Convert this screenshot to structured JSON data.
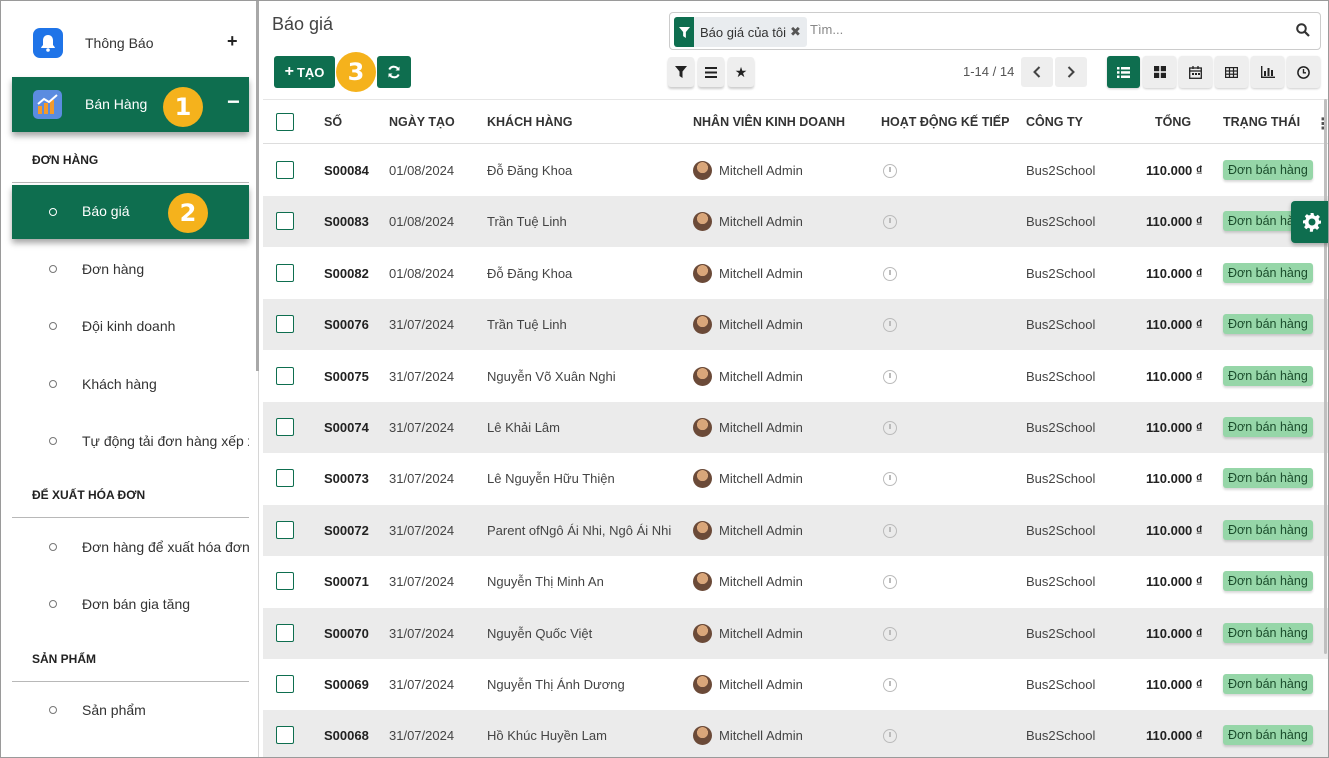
{
  "sidebar": {
    "notifications_label": "Thông Báo",
    "sales_label": "Bán Hàng",
    "sections": {
      "orders": "ĐƠN HÀNG",
      "invoice": "ĐỂ XUẤT HÓA ĐƠN",
      "products": "SẢN PHẨM"
    },
    "items": [
      {
        "label": "Báo giá"
      },
      {
        "label": "Đơn hàng"
      },
      {
        "label": "Đội kinh doanh"
      },
      {
        "label": "Khách hàng"
      },
      {
        "label": "Tự động tải đơn hàng xếp xe"
      },
      {
        "label": "Đơn hàng để xuất hóa đơn"
      },
      {
        "label": "Đơn bán gia tăng"
      },
      {
        "label": "Sản phẩm"
      }
    ]
  },
  "badges": [
    "1",
    "2",
    "3"
  ],
  "header": {
    "title": "Báo giá",
    "facet_label": "Báo giá của tôi",
    "search_placeholder": "Tìm...",
    "create_label": "TẠO",
    "pager": "1-14 / 14"
  },
  "table": {
    "columns": [
      "SỐ",
      "NGÀY TẠO",
      "KHÁCH HÀNG",
      "NHÂN VIÊN KINH DOANH",
      "HOẠT ĐỘNG KẾ TIẾP",
      "CÔNG TY",
      "TỔNG",
      "TRẠNG THÁI"
    ],
    "rows": [
      {
        "number": "S00084",
        "date": "01/08/2024",
        "customer": "Đỗ Đăng Khoa",
        "salesperson": "Mitchell Admin",
        "company": "Bus2School",
        "total": "110.000 ₫",
        "status": "Đơn bán hàng"
      },
      {
        "number": "S00083",
        "date": "01/08/2024",
        "customer": "Trần Tuệ Linh",
        "salesperson": "Mitchell Admin",
        "company": "Bus2School",
        "total": "110.000 ₫",
        "status": "Đơn bán hàng"
      },
      {
        "number": "S00082",
        "date": "01/08/2024",
        "customer": "Đỗ Đăng Khoa",
        "salesperson": "Mitchell Admin",
        "company": "Bus2School",
        "total": "110.000 ₫",
        "status": "Đơn bán hàng"
      },
      {
        "number": "S00076",
        "date": "31/07/2024",
        "customer": "Trần Tuệ Linh",
        "salesperson": "Mitchell Admin",
        "company": "Bus2School",
        "total": "110.000 ₫",
        "status": "Đơn bán hàng"
      },
      {
        "number": "S00075",
        "date": "31/07/2024",
        "customer": "Nguyễn Võ Xuân Nghi",
        "salesperson": "Mitchell Admin",
        "company": "Bus2School",
        "total": "110.000 ₫",
        "status": "Đơn bán hàng"
      },
      {
        "number": "S00074",
        "date": "31/07/2024",
        "customer": "Lê Khải Lâm",
        "salesperson": "Mitchell Admin",
        "company": "Bus2School",
        "total": "110.000 ₫",
        "status": "Đơn bán hàng"
      },
      {
        "number": "S00073",
        "date": "31/07/2024",
        "customer": "Lê Nguyễn Hữu Thiện",
        "salesperson": "Mitchell Admin",
        "company": "Bus2School",
        "total": "110.000 ₫",
        "status": "Đơn bán hàng"
      },
      {
        "number": "S00072",
        "date": "31/07/2024",
        "customer": "Parent ofNgô Ái Nhi, Ngô Ái Nhi",
        "salesperson": "Mitchell Admin",
        "company": "Bus2School",
        "total": "110.000 ₫",
        "status": "Đơn bán hàng"
      },
      {
        "number": "S00071",
        "date": "31/07/2024",
        "customer": "Nguyễn Thị Minh An",
        "salesperson": "Mitchell Admin",
        "company": "Bus2School",
        "total": "110.000 ₫",
        "status": "Đơn bán hàng"
      },
      {
        "number": "S00070",
        "date": "31/07/2024",
        "customer": "Nguyễn Quốc Việt",
        "salesperson": "Mitchell Admin",
        "company": "Bus2School",
        "total": "110.000 ₫",
        "status": "Đơn bán hàng"
      },
      {
        "number": "S00069",
        "date": "31/07/2024",
        "customer": "Nguyễn Thị Ánh Dương",
        "salesperson": "Mitchell Admin",
        "company": "Bus2School",
        "total": "110.000 ₫",
        "status": "Đơn bán hàng"
      },
      {
        "number": "S00068",
        "date": "31/07/2024",
        "customer": "Hồ Khúc Huyền Lam",
        "salesperson": "Mitchell Admin",
        "company": "Bus2School",
        "total": "110.000 ₫",
        "status": "Đơn bán hàng"
      }
    ]
  },
  "icons": [
    "bell-icon",
    "sales-chart-icon",
    "plus-icon",
    "minus-icon",
    "filter-icon",
    "close-icon",
    "search-icon",
    "refresh-icon",
    "list-icon",
    "star-icon",
    "chevron-left-icon",
    "chevron-right-icon",
    "list-view-icon",
    "kanban-view-icon",
    "calendar-view-icon",
    "pivot-view-icon",
    "graph-view-icon",
    "activity-view-icon",
    "clock-icon",
    "gear-icon",
    "kebab-icon"
  ],
  "colors": {
    "brand": "#0e6e4f",
    "badge": "#f5b21c",
    "status": "#96d6a8"
  }
}
